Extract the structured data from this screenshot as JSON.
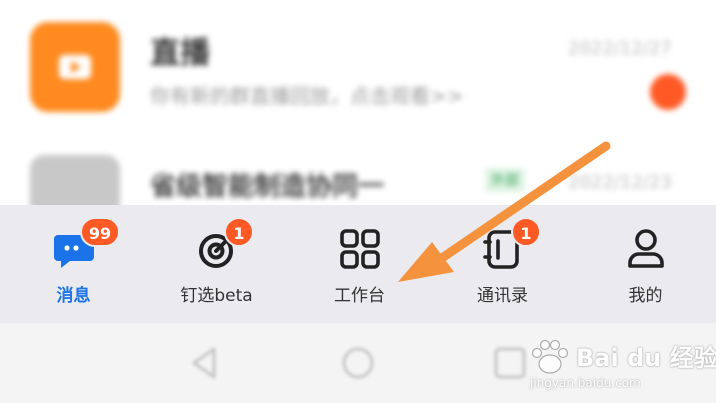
{
  "chat_list": {
    "items": [
      {
        "title": "直播",
        "preview": "你有新的群直播回放，点击观看>>",
        "time": "2022/12/27",
        "avatar": "live-video-icon"
      },
      {
        "title": "省级智能制造协同一",
        "tag": "外部",
        "time": "2022/12/23",
        "avatar": "group-avatar"
      }
    ]
  },
  "tabbar": {
    "tabs": [
      {
        "label": "消息",
        "icon": "chat-bubble-icon",
        "badge": "99",
        "active": true
      },
      {
        "label": "钉选beta",
        "icon": "target-icon",
        "badge": "1",
        "active": false
      },
      {
        "label": "工作台",
        "icon": "grid-apps-icon",
        "badge": "",
        "active": false
      },
      {
        "label": "通讯录",
        "icon": "contacts-book-icon",
        "badge": "1",
        "active": false
      },
      {
        "label": "我的",
        "icon": "person-icon",
        "badge": "",
        "active": false
      }
    ]
  },
  "navbar": {
    "buttons": [
      "back-icon",
      "home-icon",
      "recents-icon"
    ]
  },
  "watermark": {
    "brand": "Bai du 经验",
    "url": "jingyan.baidu.com"
  },
  "colors": {
    "accent": "#1a73e8",
    "badge": "#ff5a26",
    "annotation_arrow": "#f5923e",
    "live_avatar": "#ff8a1f"
  }
}
